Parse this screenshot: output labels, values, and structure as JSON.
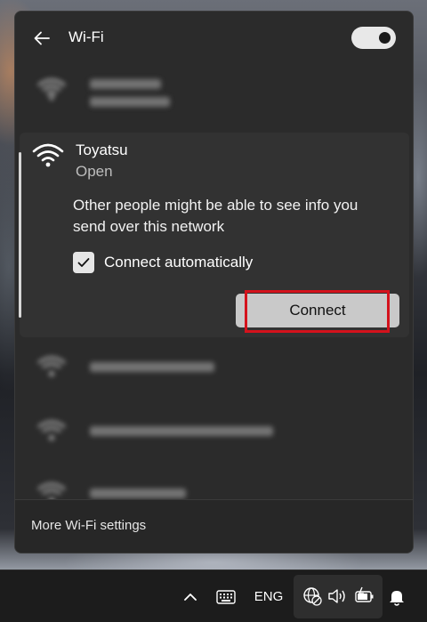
{
  "panel": {
    "title": "Wi-Fi",
    "wifi_enabled": true
  },
  "networks_blurred": [
    {
      "name": "PayaWash",
      "status": "Connected"
    },
    {
      "name": "DIOBOMPIS22.8G",
      "status": ""
    },
    {
      "name": "vetBen_S1_S3EPE_000CAH",
      "status": ""
    },
    {
      "name": "Instrapper NC",
      "status": ""
    }
  ],
  "selected_network": {
    "name": "Toyatsu",
    "security": "Open",
    "warning": "Other people might be able to see info you send over this network",
    "auto_connect_label": "Connect automatically",
    "auto_connect_checked": true,
    "connect_label": "Connect"
  },
  "footer": {
    "more_settings_label": "More Wi-Fi settings"
  },
  "taskbar": {
    "language": "ENG"
  },
  "colors": {
    "panel_bg": "#2b2b2b",
    "card_bg": "#323232",
    "button_bg": "#c9c9c9",
    "highlight": "#d4121c"
  }
}
